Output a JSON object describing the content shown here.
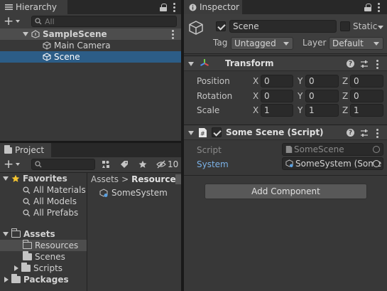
{
  "hierarchy": {
    "tab_label": "Hierarchy",
    "add_label": "+",
    "search_placeholder": "All",
    "scene_name": "SampleScene",
    "items": [
      "Main Camera",
      "Scene"
    ]
  },
  "project": {
    "tab_label": "Project",
    "add_label": "+",
    "hidden_count": "10",
    "favorites": {
      "label": "Favorites",
      "items": [
        "All Materials",
        "All Models",
        "All Prefabs"
      ]
    },
    "assets": {
      "label": "Assets",
      "items": [
        "Resources",
        "Scenes",
        "Scripts"
      ]
    },
    "packages_label": "Packages",
    "breadcrumb": [
      "Assets",
      "Resources"
    ],
    "breadcrumb_sep": ">",
    "files": [
      "SomeSystem"
    ]
  },
  "inspector": {
    "tab_label": "Inspector",
    "object_name": "Scene",
    "static_label": "Static",
    "tag_label": "Tag",
    "tag_value": "Untagged",
    "layer_label": "Layer",
    "layer_value": "Default",
    "transform": {
      "title": "Transform",
      "rows": [
        {
          "label": "Position",
          "x": "0",
          "y": "0",
          "z": "0"
        },
        {
          "label": "Rotation",
          "x": "0",
          "y": "0",
          "z": "0"
        },
        {
          "label": "Scale",
          "x": "1",
          "y": "1",
          "z": "1"
        }
      ],
      "axis": {
        "x": "X",
        "y": "Y",
        "z": "Z"
      }
    },
    "script_component": {
      "title": "Some Scene (Script)",
      "script_label": "Script",
      "script_value": "SomeScene",
      "system_label": "System",
      "system_value": "SomeSystem (Some"
    },
    "add_component_label": "Add Component"
  },
  "colors": {
    "selection": "#2c5d87",
    "panel": "#383838",
    "accent_label": "#7bb1e6"
  }
}
